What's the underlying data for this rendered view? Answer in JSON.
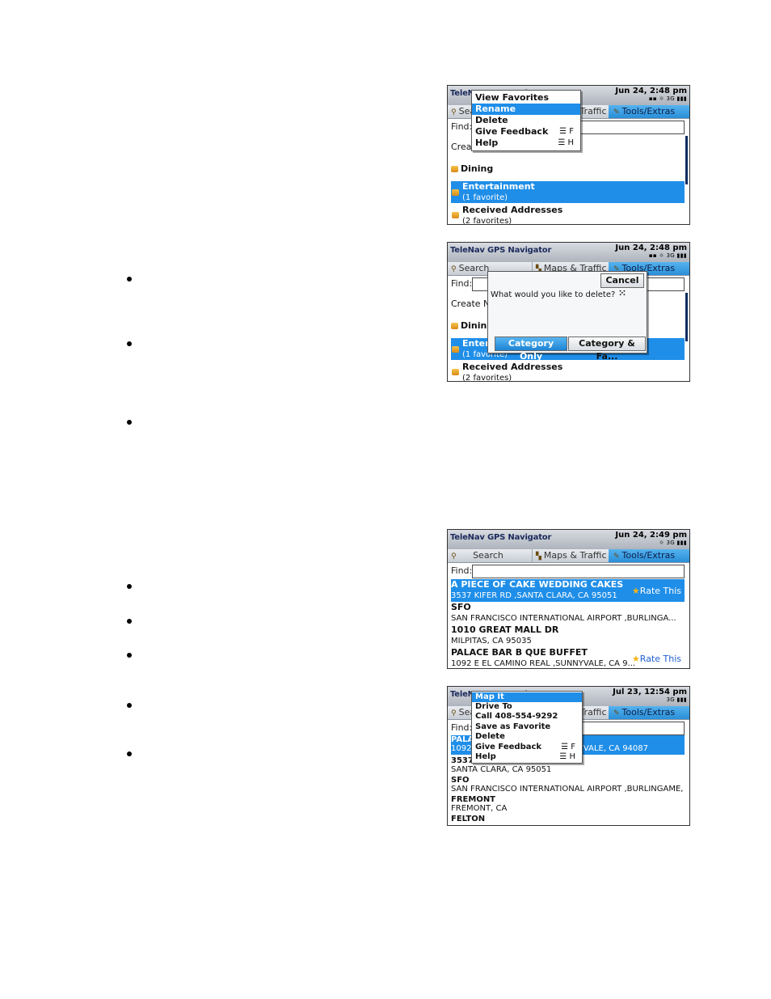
{
  "screens": [
    {
      "app_title": "TeleNav GPS Navigator",
      "datetime": "Jun 24, 2:48 pm",
      "status": "3G",
      "tabs": [
        {
          "label": "Search"
        },
        {
          "label": "Maps & Traffic"
        },
        {
          "label": "Tools/Extras"
        }
      ],
      "find_label": "Find:",
      "menu": [
        {
          "label": "View Favorites",
          "shortcut": ""
        },
        {
          "label": "Rename",
          "shortcut": ""
        },
        {
          "label": "Delete",
          "shortcut": ""
        },
        {
          "label": "Give Feedback",
          "shortcut": "F"
        },
        {
          "label": "Help",
          "shortcut": "H"
        }
      ],
      "items": [
        {
          "title": "Create New Favorite",
          "subtitle": ""
        },
        {
          "title": "Dining",
          "subtitle": ""
        },
        {
          "title": "Entertainment",
          "subtitle": "(1 favorite)"
        },
        {
          "title": "Received Addresses",
          "subtitle": "(2 favorites)"
        }
      ]
    },
    {
      "app_title": "TeleNav GPS Navigator",
      "datetime": "Jun 24, 2:48 pm",
      "status": "3G",
      "tabs": [
        {
          "label": "Search"
        },
        {
          "label": "Maps & Traffic"
        },
        {
          "label": "Tools/Extras"
        }
      ],
      "find_label": "Find:",
      "dialog": {
        "cancel": "Cancel",
        "message": "What would you like to delete?",
        "option_1": "Category Only",
        "option_2": "Category & Fa..."
      },
      "items": [
        {
          "title": "Create New Favorite",
          "subtitle": ""
        },
        {
          "title": "Dining",
          "subtitle": ""
        },
        {
          "title": "Entertainment",
          "subtitle": "(1 favorite)"
        },
        {
          "title": "Received Addresses",
          "subtitle": "(2 favorites)"
        }
      ]
    },
    {
      "app_title": "TeleNav GPS Navigator",
      "datetime": "Jun 24, 2:49 pm",
      "status": "3G",
      "tabs": [
        {
          "label": "Search"
        },
        {
          "label": "Maps & Traffic"
        },
        {
          "label": "Tools/Extras"
        }
      ],
      "find_label": "Find:",
      "rate_label": "Rate This",
      "results": [
        {
          "title": "A PIECE OF CAKE WEDDING CAKES",
          "address": "3537 KIFER RD ,SANTA CLARA, CA 95051"
        },
        {
          "title": "SFO",
          "address": "SAN FRANCISCO INTERNATIONAL AIRPORT ,BURLINGA..."
        },
        {
          "title": "1010 GREAT MALL DR",
          "address": "MILPITAS, CA 95035"
        },
        {
          "title": "PALACE BAR B QUE BUFFET",
          "address": "1092 E EL CAMINO REAL ,SUNNYVALE, CA 9..."
        }
      ]
    },
    {
      "app_title": "TeleNav GPS Navigator",
      "datetime": "Jul 23, 12:54 pm",
      "status": "3G",
      "tabs": [
        {
          "label": "Search"
        },
        {
          "label": "Maps & Traffic"
        },
        {
          "label": "Tools/Extras"
        }
      ],
      "find_label": "Find:",
      "menu": [
        {
          "label": "Map It",
          "shortcut": ""
        },
        {
          "label": "Drive To",
          "shortcut": ""
        },
        {
          "label": "Call 408-554-9292",
          "shortcut": ""
        },
        {
          "label": "Save as Favorite",
          "shortcut": ""
        },
        {
          "label": "Delete",
          "shortcut": ""
        },
        {
          "label": "Give Feedback",
          "shortcut": "F"
        },
        {
          "label": "Help",
          "shortcut": "H"
        }
      ],
      "rows": [
        {
          "title": "PALACE BAR B QUE BUFFET",
          "address": "1092 E EL CAMINO REAL ,SUNNYVALE, CA 94087"
        },
        {
          "title": "3537 KIFER RD",
          "address": "SANTA CLARA, CA 95051"
        },
        {
          "title": "SFO",
          "address": "SAN FRANCISCO INTERNATIONAL AIRPORT ,BURLINGAME, CA 9..."
        },
        {
          "title": "FREMONT",
          "address": "FREMONT, CA"
        },
        {
          "title": "FELTON",
          "address": ""
        }
      ]
    }
  ]
}
